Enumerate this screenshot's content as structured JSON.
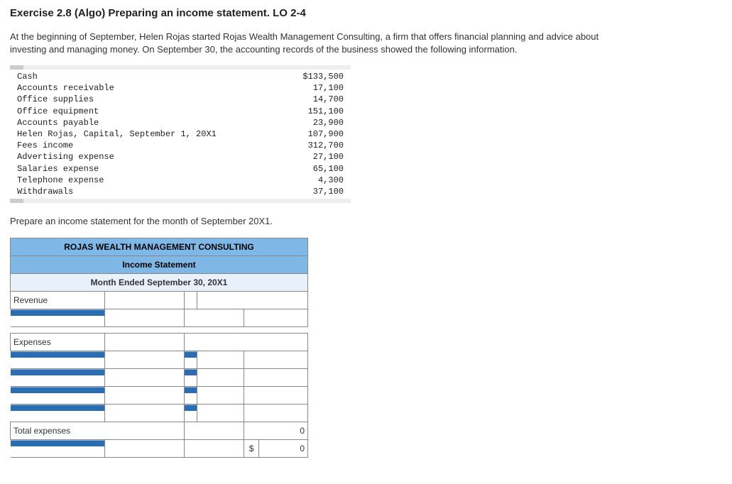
{
  "title": "Exercise 2.8 (Algo) Preparing an income statement. LO 2-4",
  "intro": "At the beginning of September, Helen Rojas started Rojas Wealth Management Consulting, a firm that offers financial planning and advice about investing and managing money. On September 30, the accounting records of the business showed the following information.",
  "accounts": [
    {
      "label": "Cash",
      "value": "$133,500"
    },
    {
      "label": "Accounts receivable",
      "value": "17,100"
    },
    {
      "label": "Office supplies",
      "value": "14,700"
    },
    {
      "label": "Office equipment",
      "value": "151,100"
    },
    {
      "label": "Accounts payable",
      "value": "23,900"
    },
    {
      "label": "Helen Rojas, Capital, September 1, 20X1",
      "value": "107,900"
    },
    {
      "label": "Fees income",
      "value": "312,700"
    },
    {
      "label": "Advertising expense",
      "value": "27,100"
    },
    {
      "label": "Salaries expense",
      "value": "65,100"
    },
    {
      "label": "Telephone expense",
      "value": "4,300"
    },
    {
      "label": "Withdrawals",
      "value": "37,100"
    }
  ],
  "prepare": "Prepare an income statement for the month of September 20X1.",
  "worksheet": {
    "company": "ROJAS WEALTH MANAGEMENT CONSULTING",
    "title": "Income Statement",
    "period": "Month Ended September 30, 20X1",
    "revenue_label": "Revenue",
    "expenses_label": "Expenses",
    "total_expenses_label": "Total expenses",
    "total_expenses_value": "0",
    "net_dollar": "$",
    "net_value": "0"
  }
}
